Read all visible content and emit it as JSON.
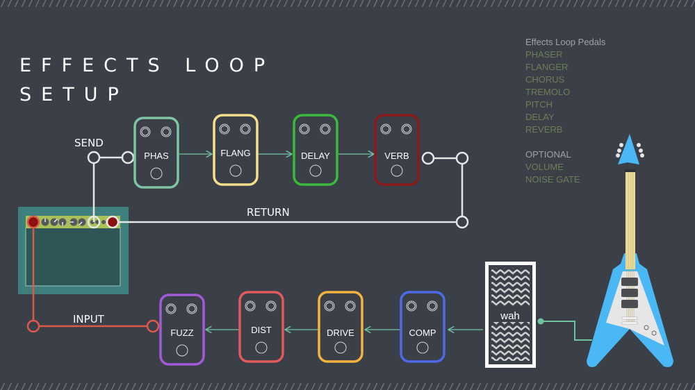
{
  "title": {
    "line1": "EFFECTS LOOP",
    "line2": "SETUP"
  },
  "legend": {
    "header": "Effects Loop Pedals",
    "items": [
      "PHASER",
      "FLANGER",
      "CHORUS",
      "TREMOLO",
      "PITCH",
      "DELAY",
      "REVERB"
    ],
    "optional_header": "OPTIONAL",
    "optional_items": [
      "VOLUME",
      "NOISE GATE"
    ]
  },
  "labels": {
    "send": "SEND",
    "return": "RETURN",
    "input": "INPUT"
  },
  "loop_pedals": [
    {
      "label": "PHAS",
      "color": "#7fc4a4"
    },
    {
      "label": "FLANG",
      "color": "#f3e08a"
    },
    {
      "label": "DELAY",
      "color": "#3cb93c"
    },
    {
      "label": "VERB",
      "color": "#8a1a1a"
    }
  ],
  "input_pedals": [
    {
      "label": "FUZZ",
      "color": "#a15bd6"
    },
    {
      "label": "DIST",
      "color": "#e35a5a"
    },
    {
      "label": "DRIVE",
      "color": "#f2b43c"
    },
    {
      "label": "COMP",
      "color": "#4e6ae6"
    }
  ],
  "wah": {
    "label": "wah"
  },
  "colors": {
    "background": "#3b3f48",
    "signal_arrow": "#6fc4a0",
    "loop_cable": "#e6e6e6",
    "input_cable": "#e0584a",
    "amp_body": "#3f7f7d",
    "amp_panel": "#a9c257",
    "guitar_body": "#4ab8f5"
  }
}
